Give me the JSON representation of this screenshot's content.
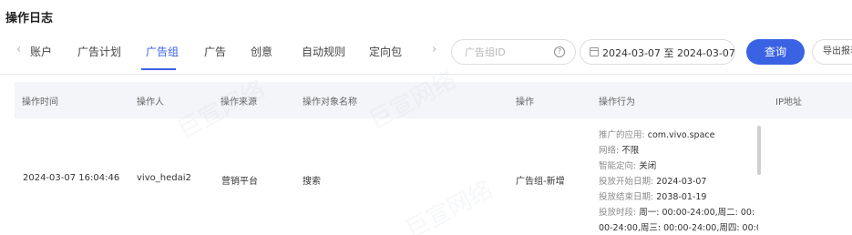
{
  "page": {
    "title": "操作日志"
  },
  "tabs": [
    {
      "label": "账户"
    },
    {
      "label": "广告计划"
    },
    {
      "label": "广告组"
    },
    {
      "label": "广告"
    },
    {
      "label": "创意"
    },
    {
      "label": "自动规则"
    },
    {
      "label": "定向包"
    }
  ],
  "nav": {
    "prev": "‹",
    "next": "›"
  },
  "search": {
    "placeholder": "广告组ID",
    "value": ""
  },
  "date_range": {
    "start": "2024-03-07",
    "separator": "至",
    "end": "2024-03-07"
  },
  "buttons": {
    "query": "查询",
    "export": "导出报表"
  },
  "table": {
    "headers": [
      "操作时间",
      "操作人",
      "操作来源",
      "操作对象名称",
      "操作",
      "操作行为",
      "IP地址"
    ],
    "rows": [
      {
        "time": "2024-03-07 16:04:46",
        "operator": "vivo_hedai2",
        "source": "营销平台",
        "object": "搜索",
        "action": "广告组-新增",
        "behavior": [
          {
            "key": "推广的应用:",
            "value": "com.vivo.space"
          },
          {
            "key": "网络:",
            "value": "不限"
          },
          {
            "key": "智能定向:",
            "value": "关闭"
          },
          {
            "key": "投放开始日期:",
            "value": "2024-03-07"
          },
          {
            "key": "投放结束日期:",
            "value": "2038-01-19"
          },
          {
            "key": "投放时段:",
            "value": "周一: 00:00-24:00,周二: 00:"
          },
          {
            "key": "",
            "value": "00-24:00,周三: 00:00-24:00,周四: 00:00-"
          }
        ],
        "ip": ""
      }
    ]
  },
  "watermark": {
    "text": "巨宣网络"
  },
  "colors": {
    "accent": "#3a63e4",
    "header_bg": "#f4f5f8",
    "border": "#dcdcdc"
  }
}
